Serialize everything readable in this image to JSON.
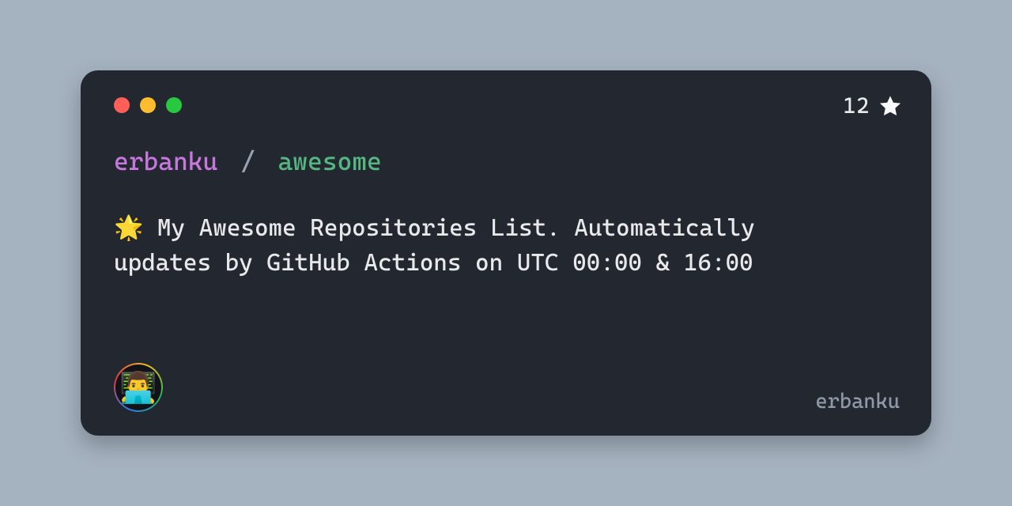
{
  "stars": "12",
  "owner": "erbanku",
  "separator": "/",
  "repo": "awesome",
  "description": "🌟 My Awesome Repositories List. Automatically updates by GitHub Actions on UTC 00:00 & 16:00",
  "avatar_emoji": "👨‍💻",
  "footer_name": "erbanku"
}
